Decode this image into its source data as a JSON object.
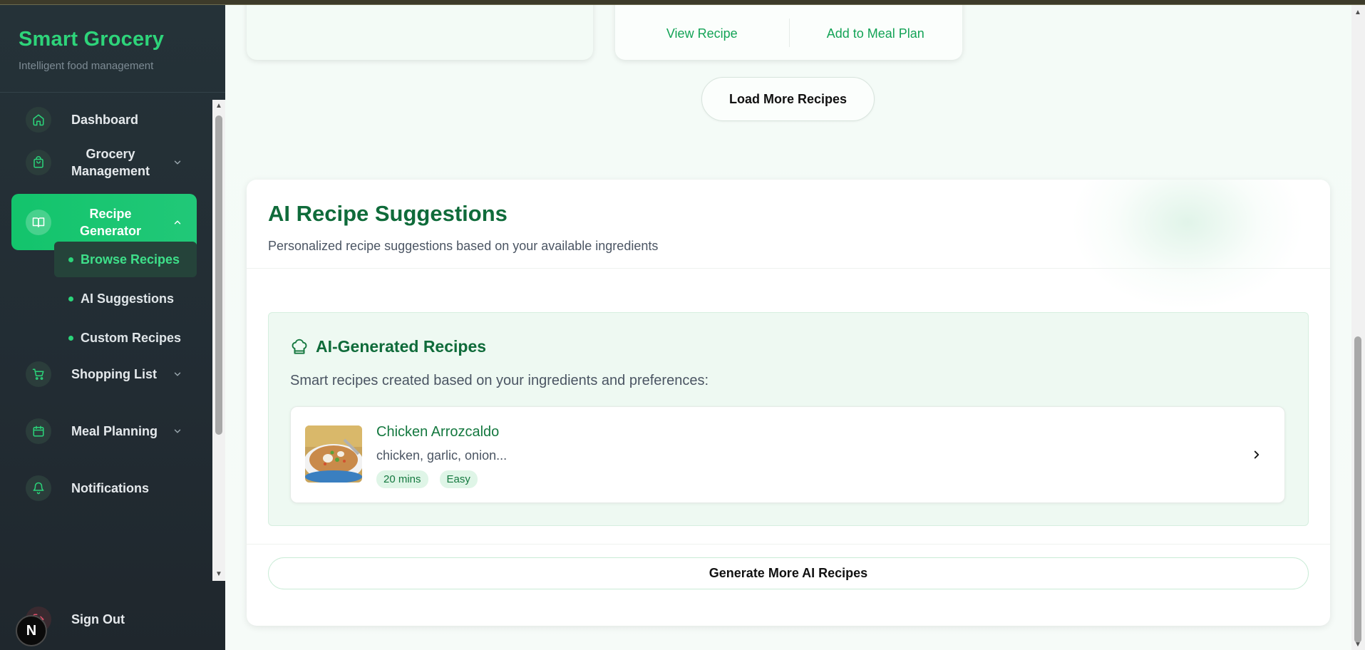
{
  "app": {
    "title": "Smart Grocery",
    "subtitle": "Intelligent food management"
  },
  "sidebar": {
    "items": [
      {
        "label": "Dashboard",
        "icon": "home-icon"
      },
      {
        "label": "Grocery Management",
        "icon": "bag-icon"
      },
      {
        "label": "Recipe Generator",
        "icon": "book-icon",
        "active": true
      },
      {
        "label": "Shopping List",
        "icon": "cart-icon"
      },
      {
        "label": "Meal Planning",
        "icon": "calendar-icon"
      },
      {
        "label": "Notifications",
        "icon": "bell-icon"
      }
    ],
    "sub_items": [
      {
        "label": "Browse Recipes",
        "active": true
      },
      {
        "label": "AI Suggestions"
      },
      {
        "label": "Custom Recipes"
      }
    ],
    "sign_out": "Sign Out",
    "badge": "N"
  },
  "main": {
    "card_actions": {
      "view": "View Recipe",
      "add": "Add to Meal Plan"
    },
    "load_more": "Load More Recipes",
    "ai_section": {
      "title": "AI Recipe Suggestions",
      "subtitle": "Personalized recipe suggestions based on your available ingredients",
      "generated": {
        "title": "AI-Generated Recipes",
        "subtitle": "Smart recipes created based on your ingredients and preferences:",
        "recipes": [
          {
            "name": "Chicken Arrozcaldo",
            "ingredients": "chicken, garlic, onion...",
            "time": "20 mins",
            "difficulty": "Easy"
          }
        ]
      },
      "generate_more": "Generate More AI Recipes"
    }
  },
  "colors": {
    "brand": "#2ed47a",
    "accent": "#13c46c",
    "heading": "#0f6b3a",
    "sidebar_bg": "#253238"
  }
}
